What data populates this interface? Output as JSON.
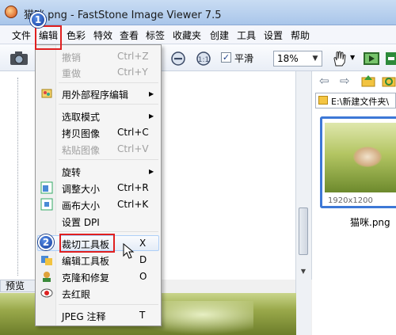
{
  "window": {
    "title": "猫咪.png - FastStone Image Viewer 7.5"
  },
  "menubar": [
    "文件",
    "编辑",
    "色彩",
    "特效",
    "查看",
    "标签",
    "收藏夹",
    "创建",
    "工具",
    "设置",
    "帮助"
  ],
  "toolbar": {
    "smooth_label": "平滑",
    "smooth_checked": "✓",
    "zoom_value": "18%"
  },
  "edit_menu": {
    "items": [
      {
        "label": "撤销",
        "shortcut": "Ctrl+Z",
        "disabled": true
      },
      {
        "label": "重做",
        "shortcut": "Ctrl+Y",
        "disabled": true
      },
      {
        "label": "用外部程序编辑",
        "shortcut": "",
        "submenu": true
      },
      {
        "label": "选取模式",
        "shortcut": "",
        "submenu": true
      },
      {
        "label": "拷贝图像",
        "shortcut": "Ctrl+C"
      },
      {
        "label": "粘贴图像",
        "shortcut": "Ctrl+V",
        "disabled": true
      },
      {
        "label": "旋转",
        "shortcut": "",
        "submenu": true
      },
      {
        "label": "调整大小",
        "shortcut": "Ctrl+R"
      },
      {
        "label": "画布大小",
        "shortcut": "Ctrl+K"
      },
      {
        "label": "设置 DPI",
        "shortcut": ""
      },
      {
        "label": "裁切工具板",
        "shortcut": "X",
        "highlighted": true
      },
      {
        "label": "编辑工具板",
        "shortcut": "D"
      },
      {
        "label": "克隆和修复",
        "shortcut": "O"
      },
      {
        "label": "去红眼",
        "shortcut": ""
      },
      {
        "label": "JPEG 注释",
        "shortcut": "T"
      }
    ]
  },
  "annotations": {
    "step1": "1",
    "step2": "2"
  },
  "preview_label": "预览",
  "browser": {
    "path": "E:\\新建文件夹\\",
    "thumbnail": {
      "dimensions": "1920x1200",
      "filename": "猫咪.png"
    }
  },
  "colors": {
    "highlight_border": "#aecff7",
    "annotation_red": "#e02020",
    "badge_blue": "#1b4fb8",
    "thumb_selected": "#3d78d6"
  }
}
